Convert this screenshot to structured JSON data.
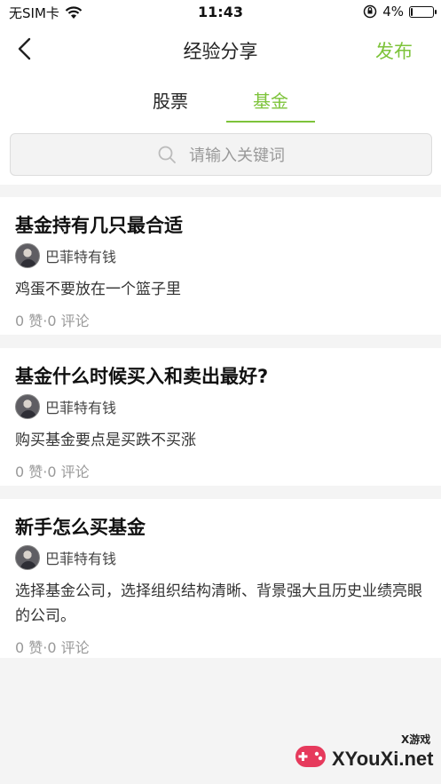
{
  "status_bar": {
    "carrier": "无SIM卡",
    "time": "11:43",
    "battery": "4%",
    "battery_level": 0.04
  },
  "nav": {
    "title": "经验分享",
    "publish_label": "发布"
  },
  "tabs": [
    {
      "label": "股票",
      "active": false
    },
    {
      "label": "基金",
      "active": true
    }
  ],
  "search": {
    "placeholder": "请输入关键词"
  },
  "posts": [
    {
      "title": "基金持有几只最合适",
      "author": "巴菲特有钱",
      "body": "鸡蛋不要放在一个篮子里",
      "meta": "0 赞·0 评论"
    },
    {
      "title": "基金什么时候买入和卖出最好?",
      "author": "巴菲特有钱",
      "body": "购买基金要点是买跌不买涨",
      "meta": "0 赞·0 评论"
    },
    {
      "title": "新手怎么买基金",
      "author": "巴菲特有钱",
      "body": "选择基金公司，选择组织结构清晰、背景强大且历史业绩亮眼的公司。",
      "meta": "0 赞·0 评论"
    }
  ],
  "watermark": {
    "small": "X游戏",
    "text": "XYouXi.net"
  },
  "colors": {
    "accent": "#7dc33a"
  }
}
